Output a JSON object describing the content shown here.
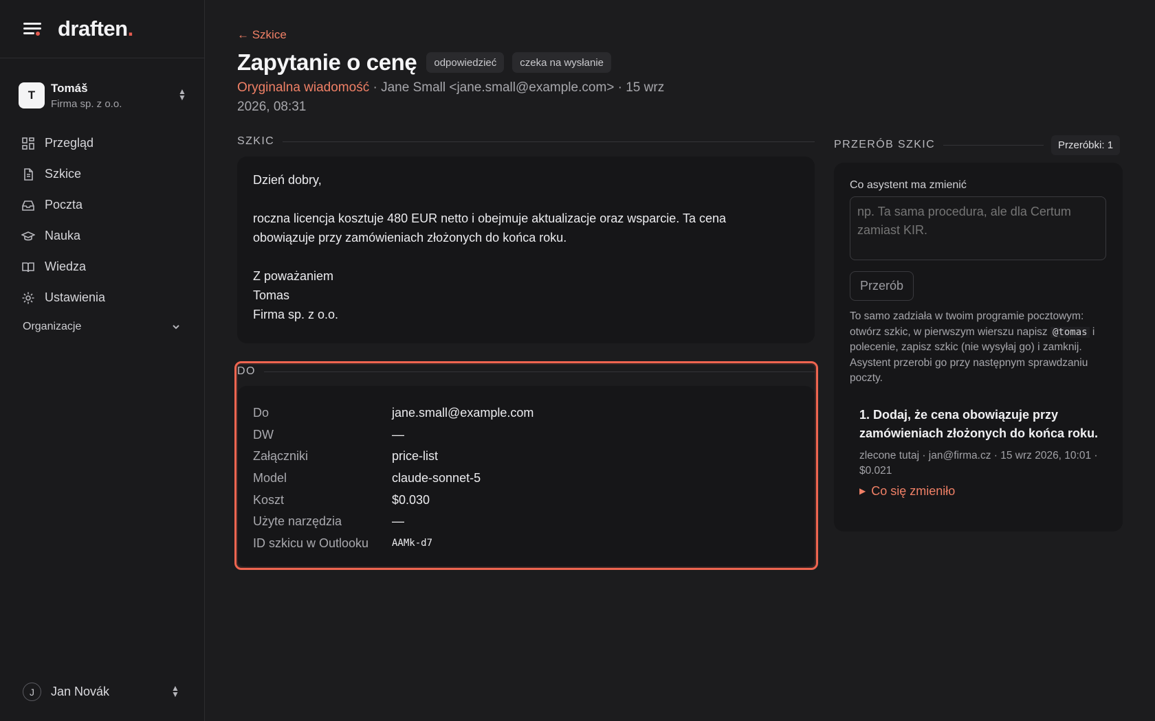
{
  "app": {
    "logo_text": "draften",
    "logo_dot": "."
  },
  "account": {
    "initial": "T",
    "name": "Tomáš",
    "company": "Firma sp. z o.o."
  },
  "nav": {
    "items": [
      {
        "label": "Przegląd",
        "icon": "dashboard-icon"
      },
      {
        "label": "Szkice",
        "icon": "document-icon"
      },
      {
        "label": "Poczta",
        "icon": "inbox-icon"
      },
      {
        "label": "Nauka",
        "icon": "graduation-cap-icon"
      },
      {
        "label": "Wiedza",
        "icon": "book-icon"
      },
      {
        "label": "Ustawienia",
        "icon": "gear-icon"
      }
    ],
    "organizations_label": "Organizacje"
  },
  "user": {
    "initial": "J",
    "name": "Jan Novák"
  },
  "header": {
    "back_label": "← Szkice",
    "title": "Zapytanie o cenę",
    "badges": [
      "odpowiedzieć",
      "czeka na wysłanie"
    ],
    "original_link": "Oryginalna wiadomość",
    "meta_text": " · Jane Small <jane.small@example.com> · 15 wrz 2026, 08:31"
  },
  "draft": {
    "section_label": "SZKIC",
    "greeting": "Dzień dobry,",
    "body_line1": "roczna licencja kosztuje 480 EUR netto i obejmuje aktualizacje oraz wsparcie. Ta cena",
    "body_line2": "obowiązuje przy zamówieniach złożonych do końca roku.",
    "closing": "Z poważaniem",
    "sig_name": "Tomas",
    "sig_company": "Firma sp. z o.o."
  },
  "details": {
    "section_label": "DO",
    "rows": [
      {
        "key": "Do",
        "value": "jane.small@example.com"
      },
      {
        "key": "DW",
        "value": "—"
      },
      {
        "key": "Załączniki",
        "value": "price-list"
      },
      {
        "key": "Model",
        "value": "claude-sonnet-5"
      },
      {
        "key": "Koszt",
        "value": "$0.030"
      },
      {
        "key": "Użyte narzędzia",
        "value": "—"
      },
      {
        "key": "ID szkicu w Outlooku",
        "value": "AAMk-d7"
      }
    ]
  },
  "rework": {
    "section_label": "PRZERÓB SZKIC",
    "count_label": "Przeróbki: 1",
    "field_label": "Co asystent ma zmienić",
    "placeholder": "np. Ta sama procedura, ale dla Certum zamiast KIR.",
    "button_label": "Przerób",
    "hint_before": "To samo zadziała w twoim programie pocztowym: otwórz szkic, w pierwszym wierszu napisz ",
    "hint_code": "@tomas",
    "hint_after": " i polecenie, zapisz szkic (nie wysyłaj go) i zamknij. Asystent przerobi go przy następnym sprawdzaniu poczty.",
    "revisions": [
      {
        "title": "1. Dodaj, że cena obowiązuje przy zamówieniach złożonych do końca roku.",
        "meta": "zlecone tutaj · jan@firma.cz · 15 wrz 2026, 10:01 · $0.021",
        "toggle_label": "Co się zmieniło"
      }
    ]
  },
  "colors": {
    "accent": "#f08066",
    "highlight": "#ef6550",
    "background": "#1c1c1e"
  }
}
